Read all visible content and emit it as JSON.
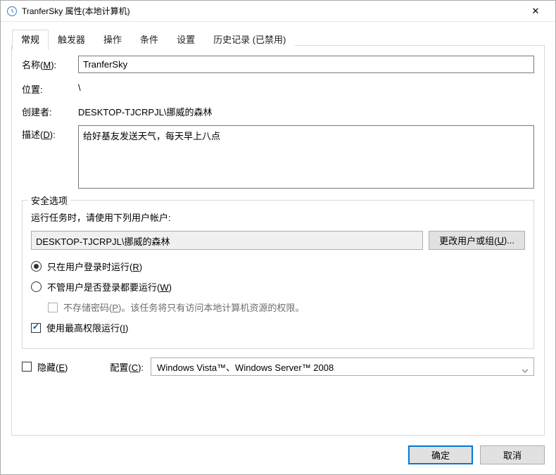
{
  "window": {
    "title": "TranferSky 属性(本地计算机)"
  },
  "tabs": [
    {
      "label": "常规",
      "active": true
    },
    {
      "label": "触发器",
      "active": false
    },
    {
      "label": "操作",
      "active": false
    },
    {
      "label": "条件",
      "active": false
    },
    {
      "label": "设置",
      "active": false
    },
    {
      "label": "历史记录 (已禁用)",
      "active": false
    }
  ],
  "general": {
    "name_label_pre": "名称(",
    "name_label_u": "M",
    "name_label_post": "):",
    "name_value": "TranferSky",
    "location_label": "位置:",
    "location_value": "\\",
    "author_label": "创建者:",
    "author_value": "DESKTOP-TJCRPJL\\挪威的森林",
    "desc_label_pre": "描述(",
    "desc_label_u": "D",
    "desc_label_post": "):",
    "desc_value": "给好基友发送天气，每天早上八点"
  },
  "security": {
    "legend": "安全选项",
    "run_as_label": "运行任务时，请使用下列用户帐户:",
    "account": "DESKTOP-TJCRPJL\\挪威的森林",
    "change_user_btn_pre": "更改用户或组(",
    "change_user_btn_u": "U",
    "change_user_btn_post": ")...",
    "radio1_pre": "只在用户登录时运行(",
    "radio1_u": "R",
    "radio1_post": ")",
    "radio2_pre": "不管用户是否登录都要运行(",
    "radio2_u": "W",
    "radio2_post": ")",
    "no_pwd_pre": "不存储密码(",
    "no_pwd_u": "P",
    "no_pwd_post": ")。该任务将只有访问本地计算机资源的权限。",
    "highest_priv_pre": "使用最高权限运行(",
    "highest_priv_u": "I",
    "highest_priv_post": ")"
  },
  "bottom": {
    "hidden_pre": "隐藏(",
    "hidden_u": "E",
    "hidden_post": ")",
    "config_label_pre": "配置(",
    "config_label_u": "C",
    "config_label_post": "):",
    "config_value": "Windows Vista™、Windows Server™ 2008"
  },
  "footer": {
    "ok": "确定",
    "cancel": "取消"
  }
}
